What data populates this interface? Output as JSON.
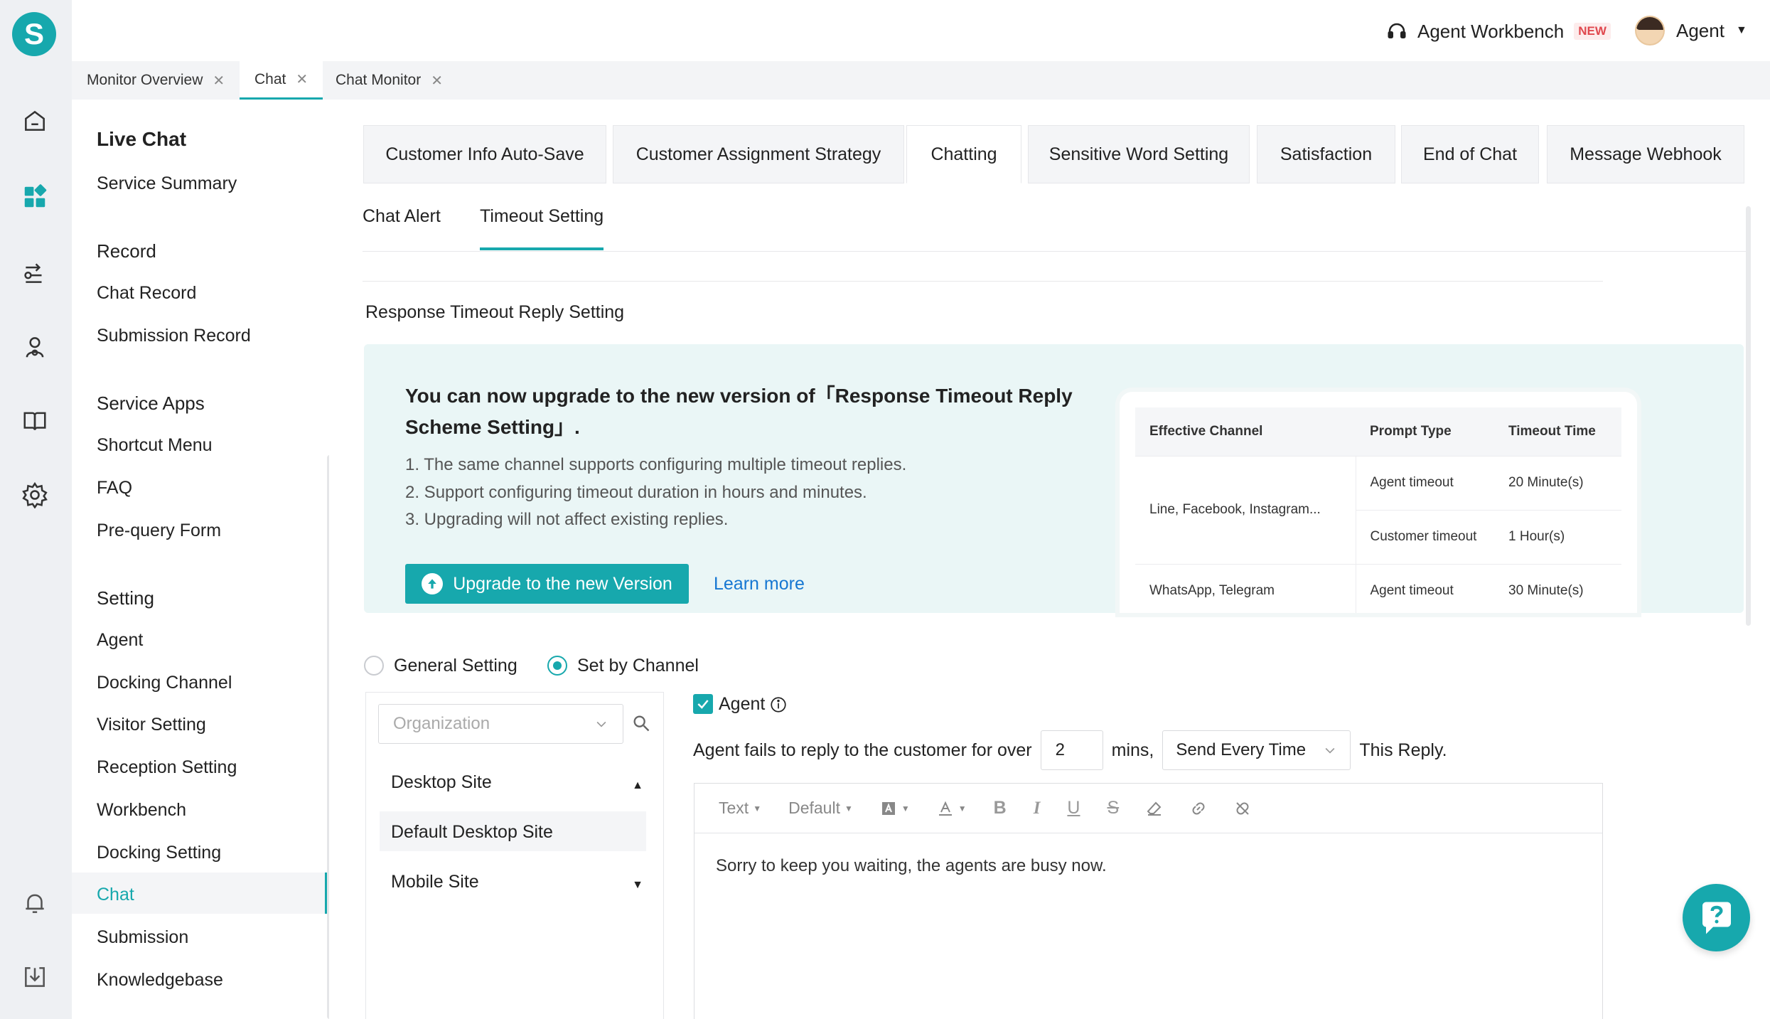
{
  "app": {
    "logo_letter": "S"
  },
  "header": {
    "workbench_label": "Agent Workbench",
    "workbench_badge": "NEW",
    "user_name": "Agent"
  },
  "page_tabs": [
    {
      "label": "Monitor Overview"
    },
    {
      "label": "Chat"
    },
    {
      "label": "Chat Monitor"
    }
  ],
  "sidebar": {
    "live_chat": "Live Chat",
    "service_summary": "Service Summary",
    "record": "Record",
    "chat_record": "Chat Record",
    "submission_record": "Submission Record",
    "service_apps": "Service Apps",
    "shortcut_menu": "Shortcut Menu",
    "faq": "FAQ",
    "pre_query_form": "Pre-query Form",
    "setting": "Setting",
    "agent": "Agent",
    "docking_channel": "Docking Channel",
    "visitor_setting": "Visitor Setting",
    "reception_setting": "Reception Setting",
    "workbench": "Workbench",
    "docking_setting": "Docking Setting",
    "chat": "Chat",
    "submission": "Submission",
    "knowledgebase": "Knowledgebase"
  },
  "config_tabs": [
    {
      "label": "Customer Info Auto-Save"
    },
    {
      "label": "Customer Assignment Strategy"
    },
    {
      "label": "Chatting"
    },
    {
      "label": "Sensitive Word Setting"
    },
    {
      "label": "Satisfaction"
    },
    {
      "label": "End of Chat"
    },
    {
      "label": "Message Webhook"
    }
  ],
  "sub_tabs": [
    {
      "label": "Chat Alert"
    },
    {
      "label": "Timeout Setting"
    }
  ],
  "section_title": "Response Timeout Reply Setting",
  "banner": {
    "title": "You can now upgrade to the new version of「Response Timeout Reply Scheme Setting」.",
    "points": [
      "1. The same channel supports configuring multiple timeout replies.",
      "2. Support configuring timeout duration in hours and minutes.",
      "3. Upgrading will not affect existing replies."
    ],
    "upgrade_label": "Upgrade to the new Version",
    "learn_more": "Learn more",
    "table": {
      "headers": [
        "Effective Channel",
        "Prompt Type",
        "Timeout Time"
      ],
      "rows": [
        {
          "channel": "Line, Facebook, Instagram...",
          "type": "Agent timeout",
          "time": "20 Minute(s)"
        },
        {
          "channel": "",
          "type": "Customer timeout",
          "time": "1 Hour(s)"
        },
        {
          "channel": "WhatsApp, Telegram",
          "type": "Agent timeout",
          "time": "30 Minute(s)"
        }
      ]
    }
  },
  "mode": {
    "general": "General Setting",
    "by_channel": "Set by Channel",
    "selected": "by_channel"
  },
  "channel_panel": {
    "org_placeholder": "Organization",
    "desktop_site": "Desktop Site",
    "default_desktop_site": "Default Desktop Site",
    "mobile_site": "Mobile Site"
  },
  "rule": {
    "agent_label": "Agent",
    "prefix": "Agent fails to reply to the customer for over",
    "minutes": "2",
    "mins_label": "mins,",
    "frequency": "Send Every Time",
    "suffix": "This Reply."
  },
  "editor": {
    "text_style": "Text",
    "font_size": "Default",
    "content": "Sorry to keep you waiting, the agents are busy now."
  },
  "colors": {
    "accent": "#17a8ad",
    "link": "#1677d2",
    "badge": "#e0484e"
  }
}
